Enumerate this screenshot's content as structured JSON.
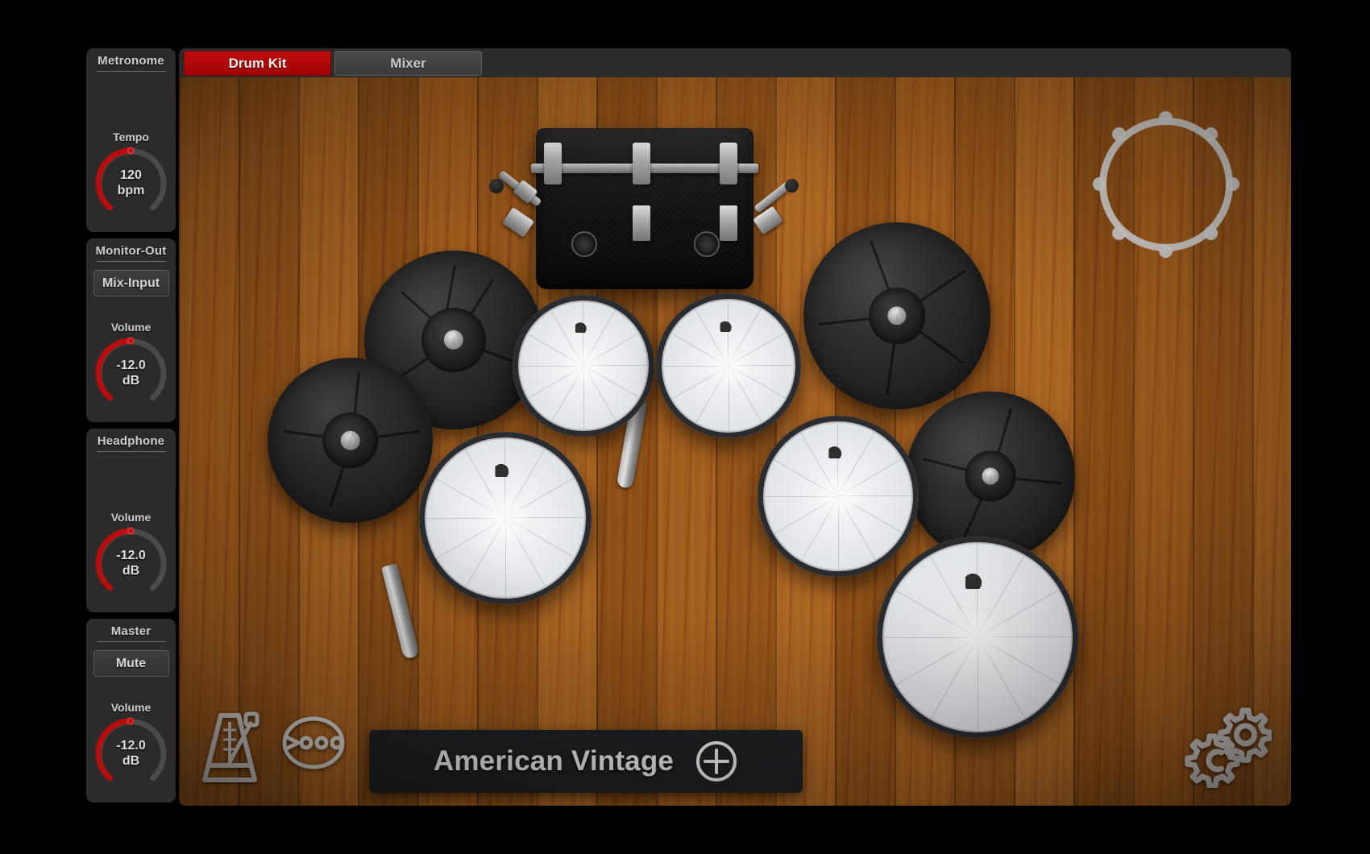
{
  "app": {
    "title": "Drum Kit"
  },
  "tabs": [
    {
      "label": "Drum Kit",
      "active": true
    },
    {
      "label": "Mixer",
      "active": false
    }
  ],
  "sidebar": {
    "panels": [
      {
        "title": "Metronome",
        "knob": {
          "label": "Tempo",
          "value": "120",
          "unit": "bpm"
        }
      },
      {
        "title": "Monitor-Out",
        "button": "Mix-Input",
        "knob": {
          "label": "Volume",
          "value": "-12.0",
          "unit": "dB"
        }
      },
      {
        "title": "Headphone",
        "knob": {
          "label": "Volume",
          "value": "-12.0",
          "unit": "dB"
        }
      },
      {
        "title": "Master",
        "button": "Mute",
        "knob": {
          "label": "Volume",
          "value": "-12.0",
          "unit": "dB"
        }
      }
    ]
  },
  "stage": {
    "kit_bar": {
      "name": "American Vintage",
      "add_icon": "plus-circle-icon"
    },
    "tools": [
      {
        "icon": "metronome-icon"
      },
      {
        "icon": "loop-playback-icon"
      },
      {
        "icon": "settings-gears-icon"
      }
    ],
    "empty_slot": {
      "icon": "empty-pad-ring-icon"
    }
  },
  "colors": {
    "accent_red": "#c00d0d",
    "panel_bg": "#2b2b2b",
    "window_bg": "#141414",
    "knob_track": "#4a4a4a",
    "knob_fill": "#b80d0d",
    "wood": "#a4601f"
  }
}
